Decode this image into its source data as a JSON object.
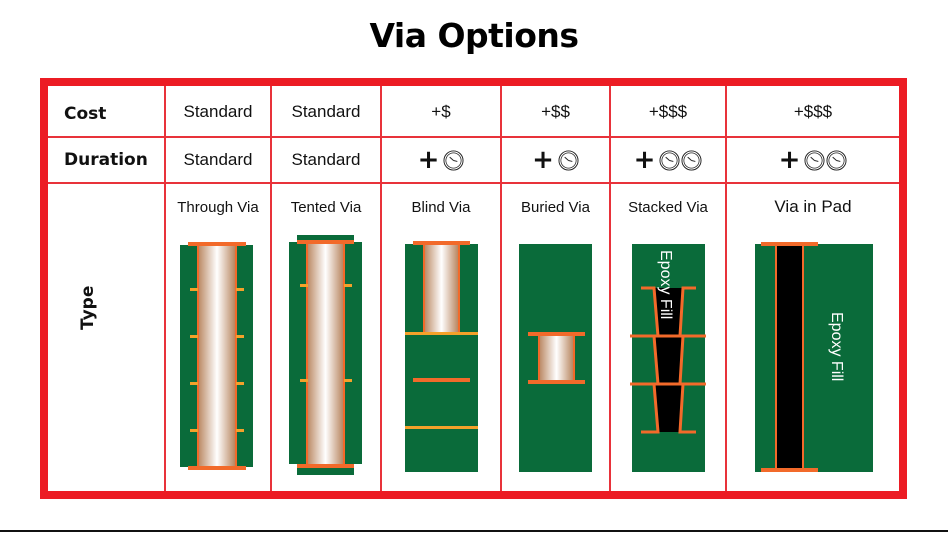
{
  "title": "Via Options",
  "colors": {
    "frame": "#ec1c24",
    "board": "#0a6b3a",
    "copper": "#f26a2a",
    "inner_layer": "#f4a12a",
    "fill": "#000000"
  },
  "rows": {
    "cost_label": "Cost",
    "duration_label": "Duration",
    "type_label": "Type"
  },
  "columns": [
    {
      "type": "Through Via",
      "cost": "Standard",
      "duration_text": "Standard",
      "duration_clocks": 0
    },
    {
      "type": "Tented Via",
      "cost": "Standard",
      "duration_text": "Standard",
      "duration_clocks": 0
    },
    {
      "type": "Blind Via",
      "cost": "+$",
      "duration_text": "+",
      "duration_clocks": 1
    },
    {
      "type": "Buried Via",
      "cost": "+$$",
      "duration_text": "+",
      "duration_clocks": 1
    },
    {
      "type": "Stacked Via",
      "cost": "+$$$",
      "duration_text": "+",
      "duration_clocks": 2
    },
    {
      "type": "Via in Pad",
      "cost": "+$$$",
      "duration_text": "+",
      "duration_clocks": 2
    }
  ],
  "annotations": {
    "stacked_fill": "Epoxy Fill",
    "pad_fill": "Epoxy Fill"
  },
  "icons": {
    "duration": "clock-icon"
  }
}
